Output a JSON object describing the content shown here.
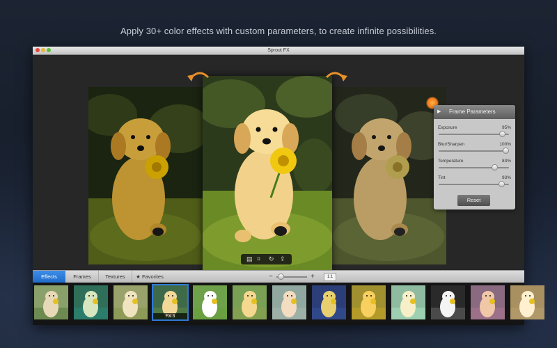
{
  "headline": "Apply 30+ color effects with custom parameters, to create infinite possibilities.",
  "window": {
    "title": "Sprout FX"
  },
  "preview_toolbar": {
    "icons": [
      "save-icon",
      "crop-icon",
      "rotate-icon",
      "share-icon"
    ]
  },
  "frame_parameters": {
    "title": "Frame Parameters",
    "params": [
      {
        "name": "Exposure",
        "value": "95%",
        "level": 0.95
      },
      {
        "name": "Blur/Sharpen",
        "value": "100%",
        "level": 1.0
      },
      {
        "name": "Temperature",
        "value": "83%",
        "level": 0.83
      },
      {
        "name": "Tint",
        "value": "93%",
        "level": 0.93
      }
    ],
    "reset_label": "Reset"
  },
  "tabs": [
    {
      "label": "Effects",
      "active": true
    },
    {
      "label": "Frames",
      "active": false
    },
    {
      "label": "Textures",
      "active": false
    },
    {
      "label": "★ Favorites",
      "active": false
    }
  ],
  "zoom": {
    "minus": "−",
    "plus": "+",
    "reset_label": "1:1",
    "level": 0.1
  },
  "effects_strip": {
    "selected_label": "FX 3",
    "thumbnails": [
      {
        "bg": "#8aa06a",
        "dog": "#e7d9b8",
        "tint": "#6d8a50"
      },
      {
        "bg": "#2f6f5a",
        "dog": "#d8e6c0",
        "tint": "#2b7c6a"
      },
      {
        "bg": "#98a26a",
        "dog": "#f0e4c0",
        "tint": "#8e9a58"
      },
      {
        "bg": "#3f6a4a",
        "dog": "#f2d899",
        "tint": "#4f7a45"
      },
      {
        "bg": "#6fa04a",
        "dog": "#ffffff",
        "tint": "#6aa040"
      },
      {
        "bg": "#7aa055",
        "dog": "#f5d890",
        "tint": "#82a050"
      },
      {
        "bg": "#90a8a0",
        "dog": "#f3dcc0",
        "tint": "#9cb0a8"
      },
      {
        "bg": "#2b3e78",
        "dog": "#e8d070",
        "tint": "#30478a"
      },
      {
        "bg": "#a09030",
        "dog": "#f8d060",
        "tint": "#b49a28"
      },
      {
        "bg": "#8fbca0",
        "dog": "#f7efc8",
        "tint": "#9cd0b0"
      },
      {
        "bg": "#2a2a2a",
        "dog": "#f4f4f4",
        "tint": "#4a4a4a"
      },
      {
        "bg": "#8a6a80",
        "dog": "#f0c8a8",
        "tint": "#9c7088"
      },
      {
        "bg": "#a89060",
        "dog": "#fff0d0",
        "tint": "#b09868"
      }
    ]
  }
}
